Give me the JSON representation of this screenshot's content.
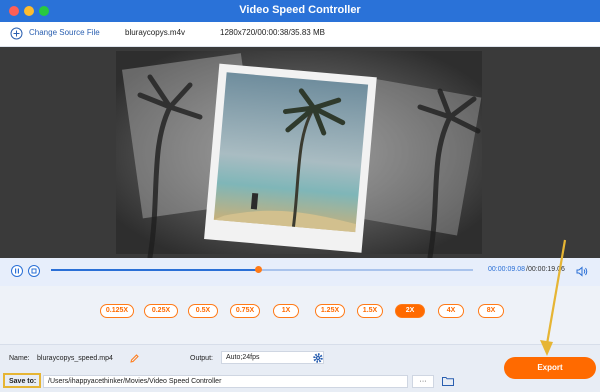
{
  "app": {
    "title": "Video Speed Controller"
  },
  "header": {
    "change_source_label": "Change Source File",
    "filename": "bluraycopys.m4v",
    "fileinfo": "1280x720/00:00:38/35.83 MB"
  },
  "playback": {
    "current_time": "00:00:09.08",
    "total_time": "/00:00:19.06",
    "progress": 0.49
  },
  "speeds": [
    {
      "label": "0.125X",
      "active": false
    },
    {
      "label": "0.25X",
      "active": false
    },
    {
      "label": "0.5X",
      "active": false
    },
    {
      "label": "0.75X",
      "active": false
    },
    {
      "label": "1X",
      "active": false
    },
    {
      "label": "1.25X",
      "active": false
    },
    {
      "label": "1.5X",
      "active": false
    },
    {
      "label": "2X",
      "active": true
    },
    {
      "label": "4X",
      "active": false
    },
    {
      "label": "8X",
      "active": false
    }
  ],
  "output": {
    "name_label": "Name:",
    "name_value": "bluraycopys_speed.mp4",
    "output_label": "Output:",
    "output_value": "Auto;24fps",
    "save_to_label": "Save to:",
    "save_path": "/Users/ihappyacethinker/Movies/Video Speed Controller",
    "more_label": "···",
    "export_label": "Export"
  },
  "colors": {
    "accent": "#ff6a00",
    "brand_blue": "#2a72d8",
    "highlight": "#e6b534"
  }
}
